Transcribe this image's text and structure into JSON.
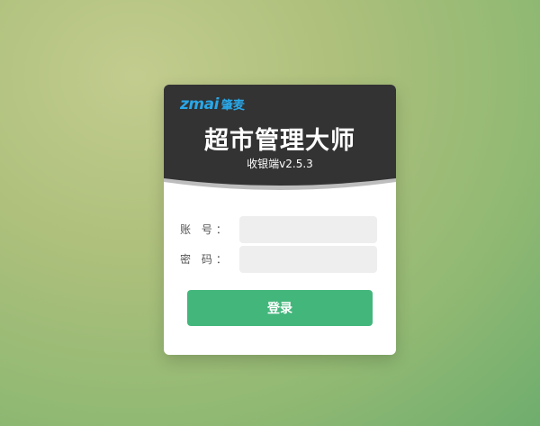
{
  "brand": {
    "latin": "zmai",
    "chinese": "肇麦"
  },
  "app": {
    "title": "超市管理大师",
    "subtitle": "收银端v2.5.3"
  },
  "form": {
    "account_label": "账 号：",
    "account_value": "",
    "password_label": "密 码：",
    "password_value": ""
  },
  "actions": {
    "login_label": "登录"
  },
  "colors": {
    "header": "#333333",
    "brand": "#29a7e8",
    "button": "#43b67c",
    "input_bg": "#eeeeee"
  }
}
